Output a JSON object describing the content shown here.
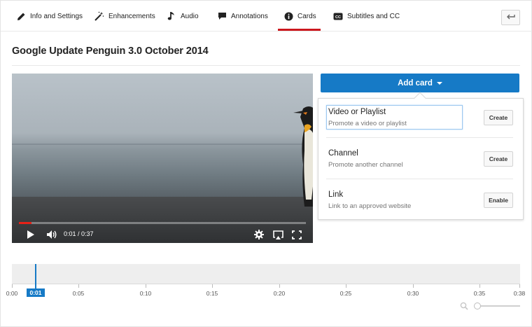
{
  "tabs": [
    {
      "label": "Info and Settings",
      "icon": "pencil-icon"
    },
    {
      "label": "Enhancements",
      "icon": "magic-wand-icon"
    },
    {
      "label": "Audio",
      "icon": "music-note-icon"
    },
    {
      "label": "Annotations",
      "icon": "speech-bubble-icon"
    },
    {
      "label": "Cards",
      "icon": "info-icon",
      "active": true
    },
    {
      "label": "Subtitles and CC",
      "icon": "cc-icon"
    }
  ],
  "back_icon": "back-arrow-icon",
  "video": {
    "title": "Google Update Penguin 3.0 October 2014",
    "timecode": "0:01 / 0:37",
    "progress_fraction": 0.027
  },
  "cards": {
    "add_label": "Add card",
    "items": [
      {
        "title": "Video or Playlist",
        "description": "Promote a video or playlist",
        "button": "Create"
      },
      {
        "title": "Channel",
        "description": "Promote another channel",
        "button": "Create"
      },
      {
        "title": "Link",
        "description": "Link to an approved website",
        "button": "Enable"
      }
    ]
  },
  "timeline": {
    "ticks": [
      "0:00",
      "0:05",
      "0:10",
      "0:15",
      "0:20",
      "0:25",
      "0:30",
      "0:35",
      "0:38"
    ],
    "playhead_label": "0:01"
  },
  "colors": {
    "accent_blue": "#167ac6",
    "active_tab_red": "#cc181e",
    "progress_red": "#e62117"
  }
}
